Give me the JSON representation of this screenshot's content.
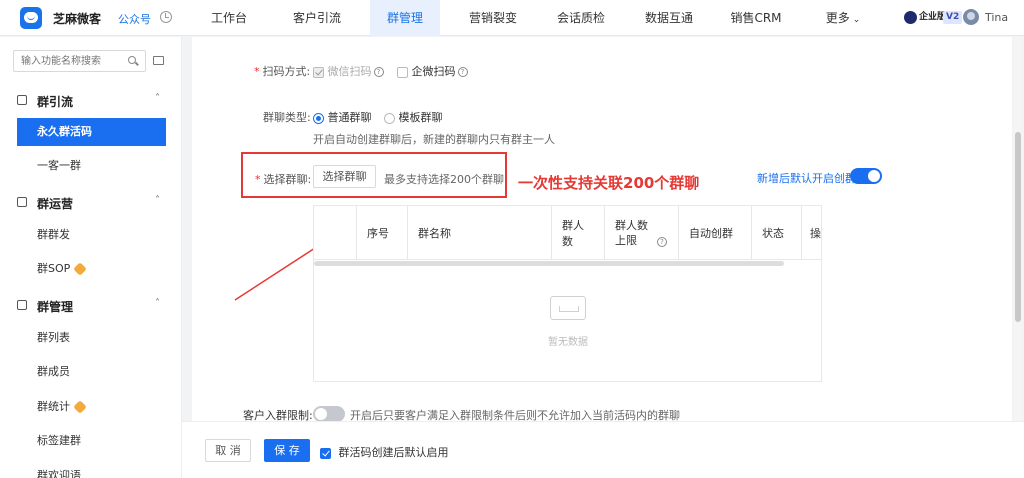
{
  "topbar": {
    "brand": "芝麻微客",
    "account": "公众号",
    "nav": [
      {
        "label": "工作台"
      },
      {
        "label": "客户引流"
      },
      {
        "label": "群管理"
      },
      {
        "label": "营销裂变"
      },
      {
        "label": "会话质检"
      },
      {
        "label": "数据互通"
      },
      {
        "label": "销售CRM"
      },
      {
        "label": "更多"
      }
    ],
    "edition_badge": "企业版",
    "version_tag": "V2",
    "user_name": "Tina"
  },
  "sidebar": {
    "search_placeholder": "输入功能名称搜索",
    "groups": [
      {
        "label": "群引流",
        "items": [
          {
            "label": "永久群活码"
          },
          {
            "label": "一客一群"
          }
        ]
      },
      {
        "label": "群运营",
        "items": [
          {
            "label": "群群发"
          },
          {
            "label": "群SOP"
          }
        ]
      },
      {
        "label": "群管理",
        "items": [
          {
            "label": "群列表"
          },
          {
            "label": "群成员"
          },
          {
            "label": "群统计"
          },
          {
            "label": "标签建群"
          },
          {
            "label": "群欢迎语"
          }
        ]
      }
    ]
  },
  "form": {
    "scan_label": "扫码方式:",
    "scan_options": [
      {
        "label": "微信扫码"
      },
      {
        "label": "企微扫码"
      }
    ],
    "group_type_label": "群聊类型:",
    "group_type_options": [
      {
        "label": "普通群聊"
      },
      {
        "label": "模板群聊"
      }
    ],
    "group_type_hint": "开启自动创建群聊后，新建的群聊内只有群主一人",
    "select_label": "选择群聊:",
    "select_button": "选择群聊",
    "select_hint": "最多支持选择200个群聊",
    "annotation": "一次性支持关联200个群聊",
    "auto_create_label": "新增后默认开启创群",
    "table_headers": [
      "序号",
      "群名称",
      "群人数",
      "群人数上限",
      "自动创群",
      "状态",
      "操"
    ],
    "empty_text": "暂无数据",
    "limit_label": "客户入群限制:",
    "limit_hint": "开启后只要客户满足入群限制条件后则不允许加入当前活码内的群聊"
  },
  "footer": {
    "cancel": "取 消",
    "save": "保 存",
    "auto_enable_label": "群活码创建后默认启用"
  },
  "colors": {
    "accent": "#1a6ff0",
    "annotation": "#e53935"
  }
}
